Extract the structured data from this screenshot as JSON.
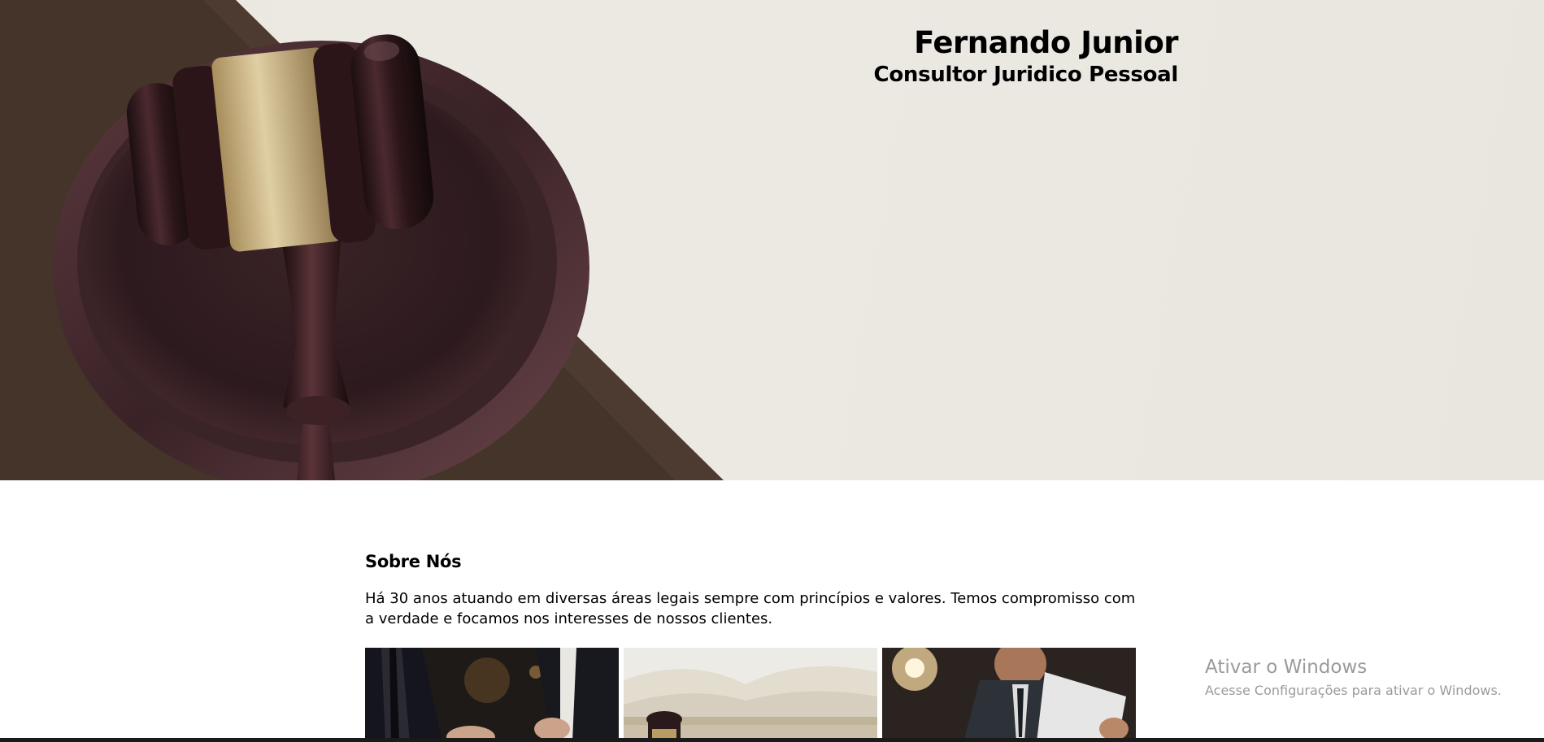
{
  "hero": {
    "name": "Fernando Junior",
    "role": "Consultor Juridico Pessoal",
    "image_icon": "gavel-icon"
  },
  "about": {
    "heading": "Sobre Nós",
    "text": "Há 30 anos atuando em diversas áreas legais sempre com princípios e valores. Temos compromisso com a verdade e focamos nos interesses de nossos clientes."
  },
  "gallery": {
    "items": [
      {
        "icon": "business-meeting-photo"
      },
      {
        "icon": "open-book-photo"
      },
      {
        "icon": "man-reading-document-photo"
      }
    ]
  },
  "watermark": {
    "title": "Ativar o Windows",
    "subtitle": "Acesse Configurações para ativar o Windows."
  },
  "colors": {
    "hero_background": "#ebe8e2",
    "text": "#000000",
    "watermark": "#8a8a8a"
  }
}
